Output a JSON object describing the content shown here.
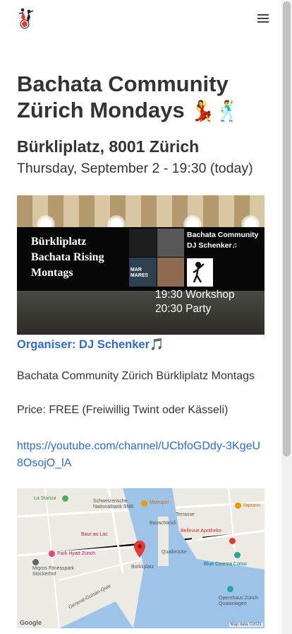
{
  "nav": {
    "logo_icon": "dancing-couple-logo",
    "menu_icon": "hamburger-menu-icon"
  },
  "event": {
    "title": "Bachata Community Zürich Mondays",
    "title_emoji": "💃🕺",
    "venue": "Bürkliplatz, 8001 Zürich",
    "datetime": "Thursday, September 2 - 19:30 (today)"
  },
  "banner": {
    "title_lines": [
      "Bürkliplatz",
      "Bachata Rising",
      "Montags"
    ],
    "dj_lines": [
      "Bachata Community",
      "DJ Schenker♫"
    ],
    "mini_text": "MAR MARES",
    "time_lines": [
      "19:30 Workshop",
      "20:30 Party"
    ]
  },
  "organiser": {
    "label": "Organiser: DJ Schenker🎵"
  },
  "description": "Bachata Community Zürich Bürkliplatz Montags",
  "price": "Price: FREE (Freiwillig Twint oder Kässeli)",
  "youtube_link": "https://youtube.com/channel/UCbfoGDdy-3KgeU8OsojO_lA",
  "map": {
    "labels": {
      "la_stanza": "La Stanza",
      "snb": "Schweizerische Nationalbank SNB",
      "metropol": "Metropol",
      "terrasse": "Terrasse",
      "vapiano": "Vapiano",
      "bauschanzli": "Bauschänzli",
      "bellevue": "Bellevue Apotheke",
      "baur": "Baur au Lac",
      "park_hyatt": "Park Hyatt Zürich",
      "migros": "Migros Fitnesspark Stockerhof",
      "buerkliplatz": "Bürkliplatz",
      "blue_cinema": "Blue Cinema Corso",
      "opernhaus": "Opernhaus Zürich Quaianlagen",
      "quaibruecke": "Quaibrücke",
      "general_guisan": "General-Guisan-Quai"
    },
    "attribution": "Google",
    "map_data": "Map data ©2021"
  },
  "colors": {
    "link": "#2f6cc4",
    "text": "#333333",
    "marker": "#e53935"
  }
}
